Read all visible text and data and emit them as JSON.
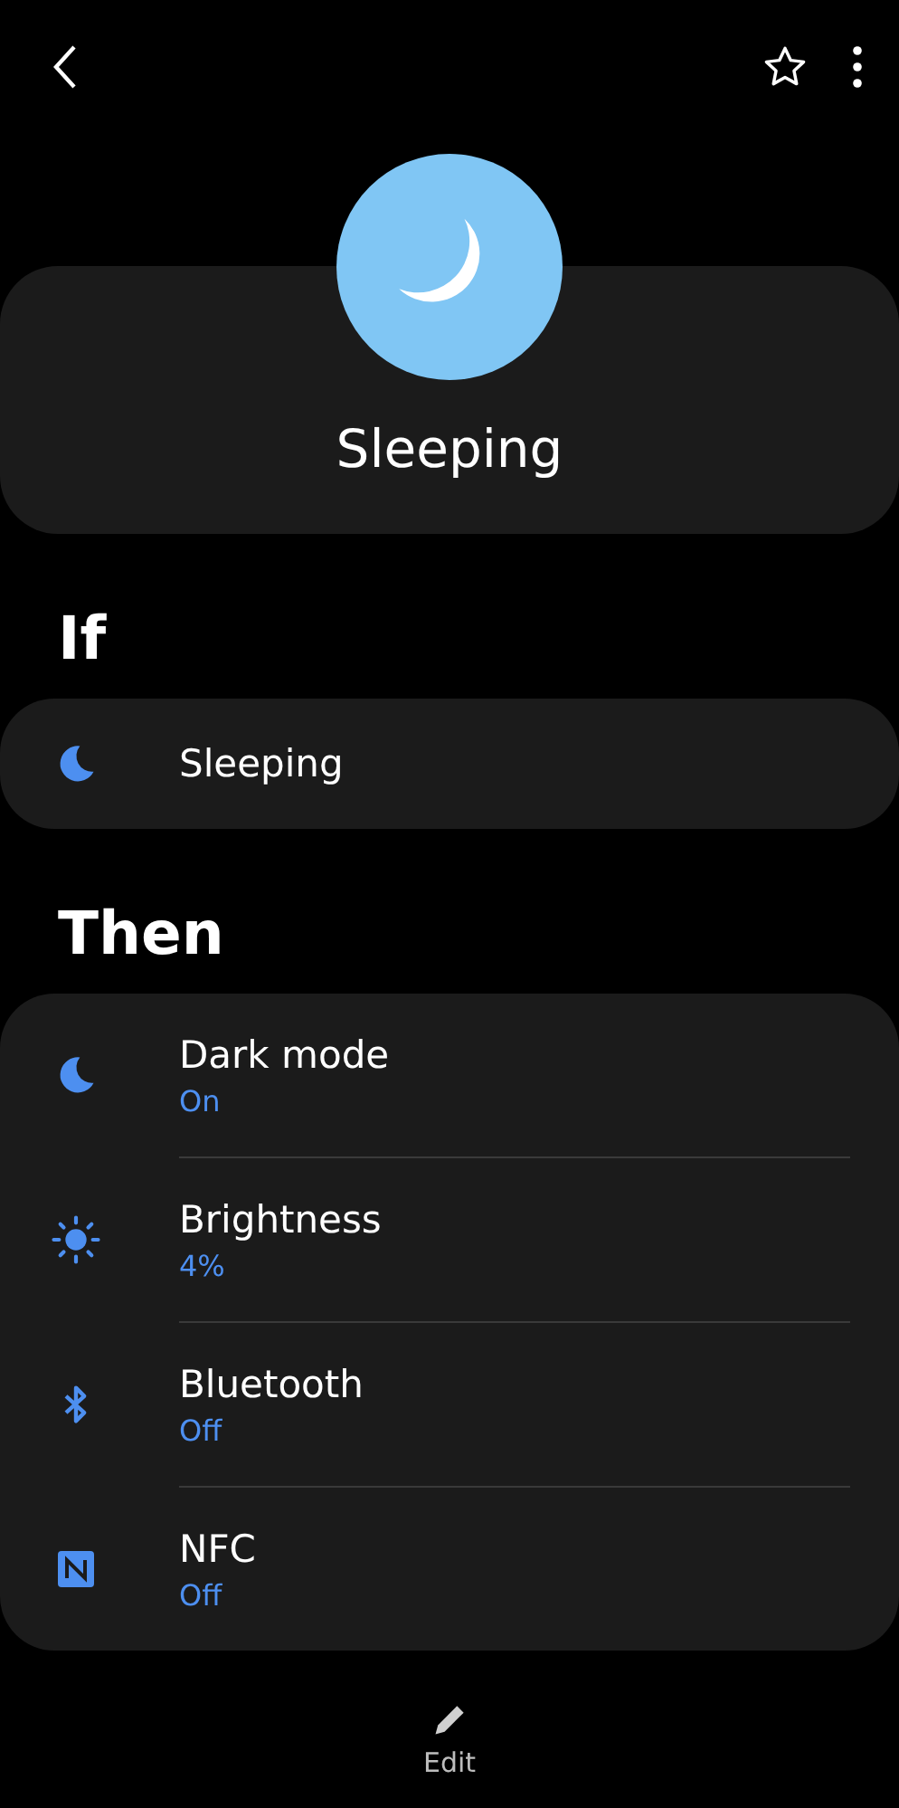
{
  "profile": {
    "title": "Sleeping"
  },
  "if_section": {
    "heading": "If",
    "conditions": [
      {
        "kind": "moon",
        "label": "Sleeping"
      }
    ]
  },
  "then_section": {
    "heading": "Then",
    "actions": [
      {
        "kind": "moon",
        "label": "Dark mode",
        "value": "On"
      },
      {
        "kind": "sun",
        "label": "Brightness",
        "value": "4%"
      },
      {
        "kind": "bluetooth",
        "label": "Bluetooth",
        "value": "Off"
      },
      {
        "kind": "nfc",
        "label": "NFC",
        "value": "Off"
      }
    ]
  },
  "bottom_bar": {
    "edit_label": "Edit"
  }
}
